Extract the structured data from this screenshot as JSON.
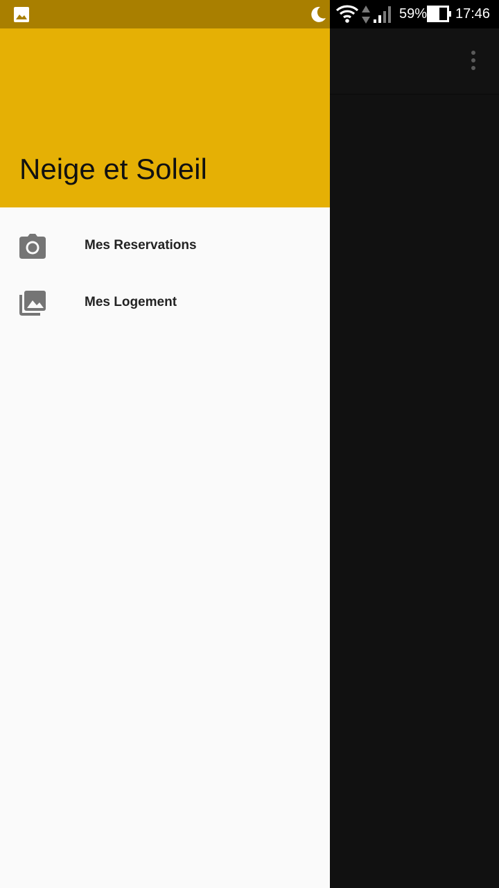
{
  "status_bar": {
    "battery_percent": "59%",
    "time": "17:46",
    "icons": [
      "image-notification-icon",
      "moon-icon",
      "wifi-icon",
      "data-arrows-icon",
      "signal-icon",
      "battery-icon"
    ]
  },
  "app_bar": {
    "overflow_icon": "more-vert-icon"
  },
  "drawer": {
    "title": "Neige et Soleil",
    "header_color": "#e5b005",
    "items": [
      {
        "label": "Mes Reservations",
        "icon": "camera-icon"
      },
      {
        "label": "Mes Logement",
        "icon": "photo-library-icon"
      }
    ]
  },
  "colors": {
    "status_bar_left": "#a97f00",
    "scrim": "#111111",
    "drawer_background": "#fafafa",
    "icon_gray": "#757575"
  }
}
